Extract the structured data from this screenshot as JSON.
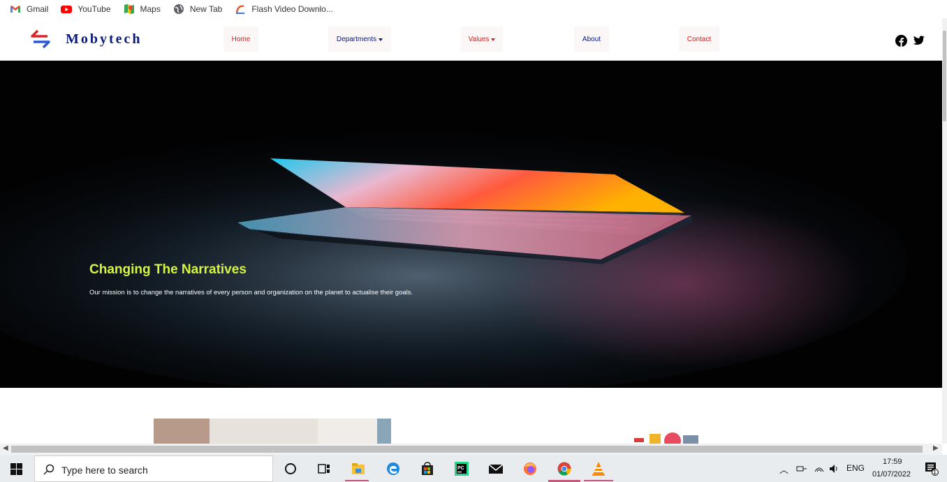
{
  "bookmarks": [
    {
      "label": "Gmail",
      "icon": "gmail-icon"
    },
    {
      "label": "YouTube",
      "icon": "youtube-icon"
    },
    {
      "label": "Maps",
      "icon": "maps-icon"
    },
    {
      "label": "New Tab",
      "icon": "globe-icon"
    },
    {
      "label": "Flash Video Downlo...",
      "icon": "flash-downloader-icon"
    }
  ],
  "site": {
    "brand": "Mobytech",
    "nav": {
      "home": "Home",
      "departments": "Departments",
      "values": "Values",
      "about": "About",
      "contact": "Contact"
    },
    "social": [
      "facebook-icon",
      "twitter-icon"
    ]
  },
  "hero": {
    "title": "Changing The Narratives",
    "subtitle": "Our mission is to change the narratives of every person and organization on the planet to actualise their goals."
  },
  "colors": {
    "brand": "#0a1a7a",
    "nav_red": "#d62020",
    "hero_title": "#d7f542"
  },
  "taskbar": {
    "search_placeholder": "Type here to search",
    "language": "ENG",
    "time": "17:59",
    "date": "01/07/2022",
    "notification_count": "1",
    "pinned": [
      "cortana-icon",
      "task-view-icon",
      "file-explorer-icon",
      "edge-icon",
      "store-icon",
      "pycharm-icon",
      "mail-icon",
      "firefox-icon",
      "chrome-icon",
      "vlc-icon"
    ]
  }
}
